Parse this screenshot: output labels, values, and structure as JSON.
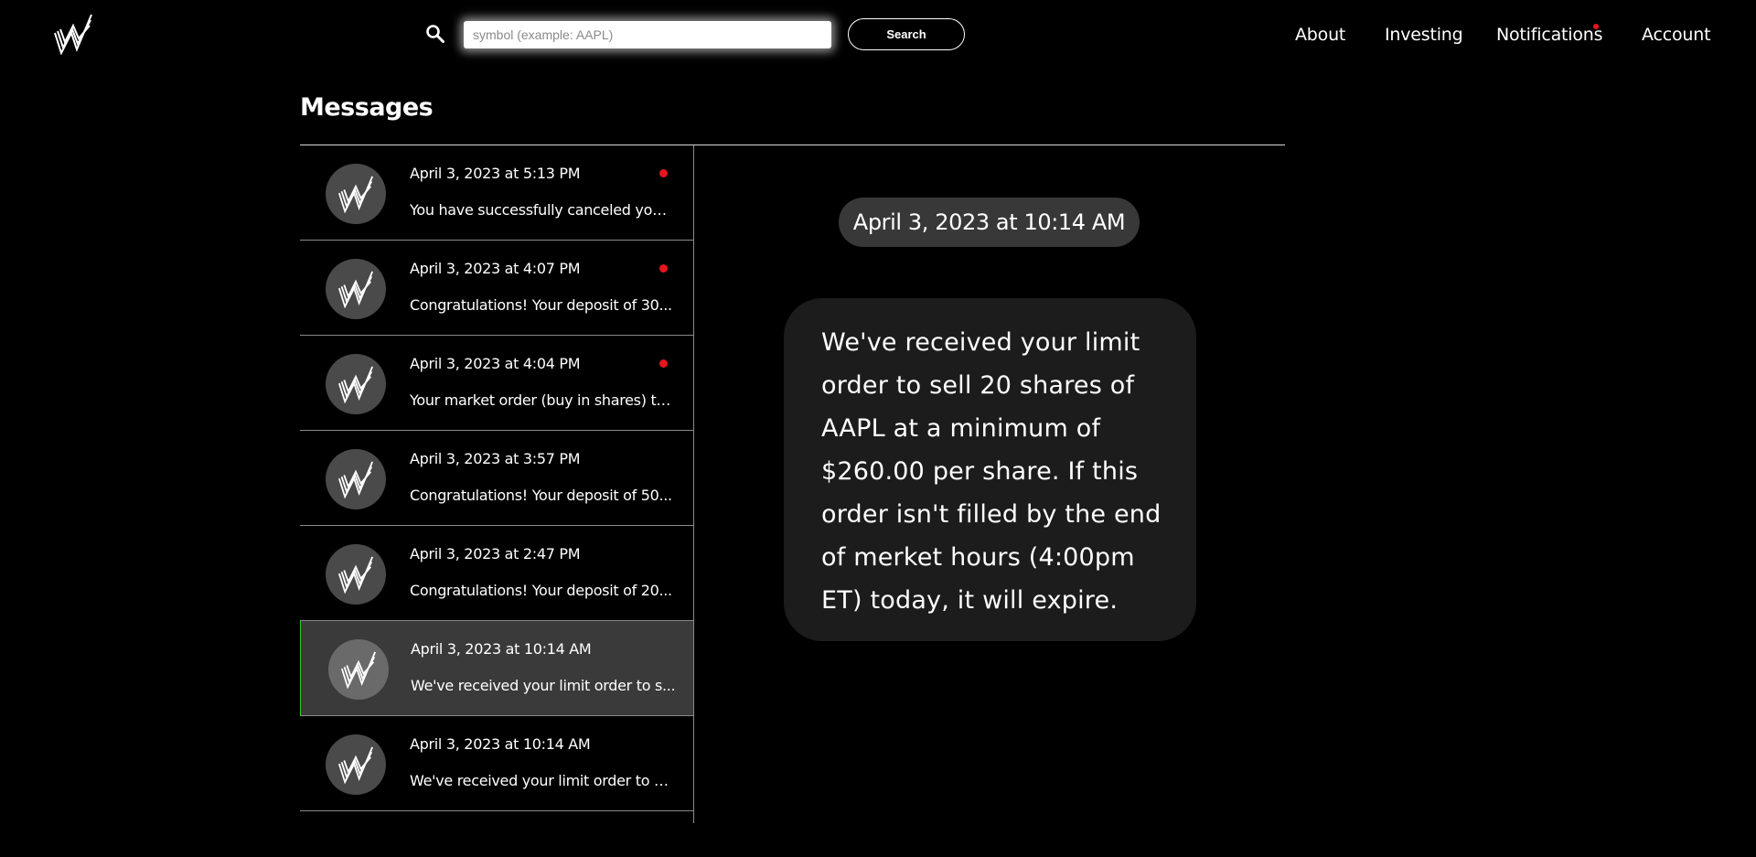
{
  "header": {
    "search_placeholder": "symbol (example: AAPL)",
    "search_button": "Search",
    "nav": {
      "about": "About",
      "investing": "Investing",
      "notifications": "Notifications",
      "account": "Account"
    },
    "notifications_unread": true
  },
  "page": {
    "title": "Messages"
  },
  "messages": [
    {
      "date": "April 3, 2023 at 5:13 PM",
      "preview": "You have successfully canceled your...",
      "unread": true,
      "selected": false
    },
    {
      "date": "April 3, 2023 at 4:07 PM",
      "preview": "Congratulations! Your deposit of 30...",
      "unread": true,
      "selected": false
    },
    {
      "date": "April 3, 2023 at 4:04 PM",
      "preview": "Your market order (buy in shares) to...",
      "unread": true,
      "selected": false
    },
    {
      "date": "April 3, 2023 at 3:57 PM",
      "preview": "Congratulations! Your deposit of 50...",
      "unread": false,
      "selected": false
    },
    {
      "date": "April 3, 2023 at 2:47 PM",
      "preview": "Congratulations! Your deposit of 20...",
      "unread": false,
      "selected": false
    },
    {
      "date": "April 3, 2023 at 10:14 AM",
      "preview": "We've received your limit order to s...",
      "unread": false,
      "selected": true
    },
    {
      "date": "April 3, 2023 at 10:14 AM",
      "preview": "We've received your limit order to b...",
      "unread": false,
      "selected": false
    }
  ],
  "detail": {
    "date": "April 3, 2023 at 10:14 AM",
    "body": "We've received your limit order to sell 20 shares of AAPL at a minimum of $260.00 per share. If this order isn't filled by the end of merket hours (4:00pm ET) today, it will expire."
  },
  "colors": {
    "background": "#000000",
    "unread_dot": "#e8141e",
    "selected_row": "#3a3a3a",
    "selected_accent": "#2ecc2e",
    "bubble": "#1c1c1c"
  },
  "icons": [
    "logo-icon",
    "search-icon",
    "avatar-logo-icon"
  ]
}
